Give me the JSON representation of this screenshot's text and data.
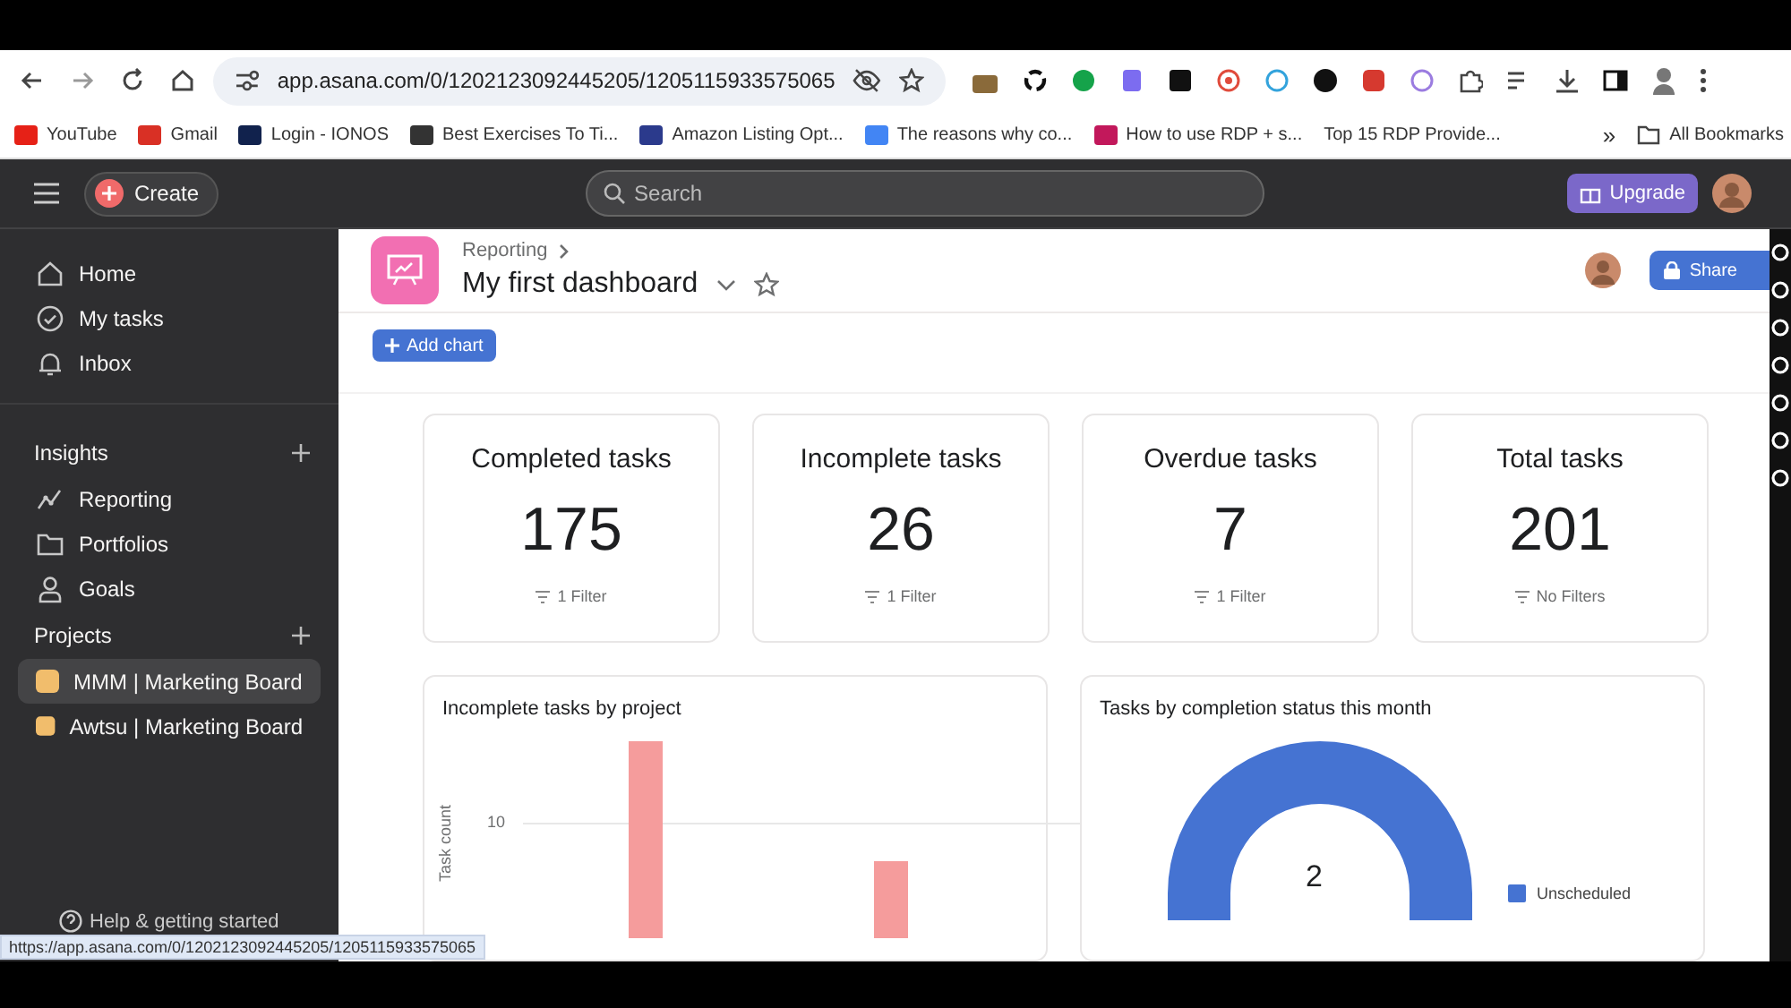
{
  "browser": {
    "url": "app.asana.com/0/1202123092445205/1205115933575065",
    "bookmarks": [
      {
        "label": "YouTube",
        "color": "#e62117"
      },
      {
        "label": "Gmail",
        "color": "#d93025"
      },
      {
        "label": "Login - IONOS",
        "color": "#11224d"
      },
      {
        "label": "Best Exercises To Ti...",
        "color": "#333333"
      },
      {
        "label": "Amazon Listing Opt...",
        "color": "#2b3a8c"
      },
      {
        "label": "The reasons why co...",
        "color": "#4285f4"
      },
      {
        "label": "How to use RDP + s...",
        "color": "#c2185b"
      },
      {
        "label": "Top 15 RDP Provide..."
      }
    ],
    "overflow": "»",
    "all_bookmarks": "All Bookmarks"
  },
  "topbar": {
    "create": "Create",
    "search_placeholder": "Search",
    "upgrade": "Upgrade"
  },
  "sidebar": {
    "nav": [
      {
        "label": "Home",
        "kind": "home"
      },
      {
        "label": "My tasks",
        "kind": "check"
      },
      {
        "label": "Inbox",
        "kind": "bell"
      }
    ],
    "sections": [
      {
        "title": "Insights",
        "items": [
          {
            "label": "Reporting",
            "kind": "chart"
          },
          {
            "label": "Portfolios",
            "kind": "folder"
          },
          {
            "label": "Goals",
            "kind": "person"
          }
        ]
      },
      {
        "title": "Projects",
        "items": [
          {
            "label": "MMM | Marketing Board",
            "kind": "project",
            "color": "#f1bd6c",
            "selected": true
          },
          {
            "label": "Awtsu | Marketing Board",
            "kind": "project",
            "color": "#f1bd6c",
            "selected": false
          }
        ]
      }
    ],
    "help": "Help & getting started"
  },
  "dashboard": {
    "breadcrumb": "Reporting",
    "title": "My first dashboard",
    "share": "Share",
    "add_chart": "Add chart",
    "stats": [
      {
        "label": "Completed tasks",
        "value": "175",
        "filter": "1 Filter"
      },
      {
        "label": "Incomplete tasks",
        "value": "26",
        "filter": "1 Filter"
      },
      {
        "label": "Overdue tasks",
        "value": "7",
        "filter": "1 Filter"
      },
      {
        "label": "Total tasks",
        "value": "201",
        "filter": "No Filters"
      }
    ],
    "charts": [
      {
        "kind": "bar",
        "title": "Incomplete tasks by project",
        "ylabel": "Task count",
        "tick": "10"
      },
      {
        "kind": "donut",
        "title": "Tasks by completion status this month",
        "center": "2",
        "legend": [
          {
            "label": "Unscheduled",
            "color": "#4573d2"
          }
        ]
      }
    ]
  },
  "status_url": "https://app.asana.com/0/1202123092445205/1205115933575065"
}
